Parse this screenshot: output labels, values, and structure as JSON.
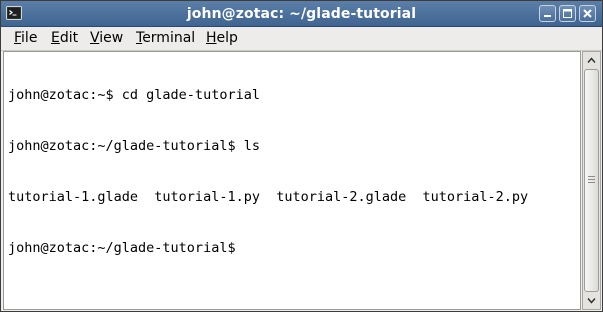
{
  "window": {
    "title": "john@zotac: ~/glade-tutorial"
  },
  "title_icon": "terminal-icon",
  "window_buttons": {
    "minimize_icon": "minimize-icon",
    "maximize_icon": "maximize-icon",
    "close_icon": "close-icon"
  },
  "menu": {
    "file": {
      "mnemonic": "F",
      "rest": "ile"
    },
    "edit": {
      "mnemonic": "E",
      "rest": "dit"
    },
    "view": {
      "mnemonic": "V",
      "rest": "iew"
    },
    "terminal": {
      "mnemonic": "T",
      "rest": "erminal"
    },
    "help": {
      "mnemonic": "H",
      "rest": "elp"
    }
  },
  "terminal": {
    "lines": [
      "john@zotac:~$ cd glade-tutorial",
      "john@zotac:~/glade-tutorial$ ls",
      "tutorial-1.glade  tutorial-1.py  tutorial-2.glade  tutorial-2.py",
      "john@zotac:~/glade-tutorial$ "
    ]
  },
  "scrollbar": {
    "up_icon": "scroll-up-arrow-icon",
    "down_icon": "scroll-down-arrow-icon"
  }
}
